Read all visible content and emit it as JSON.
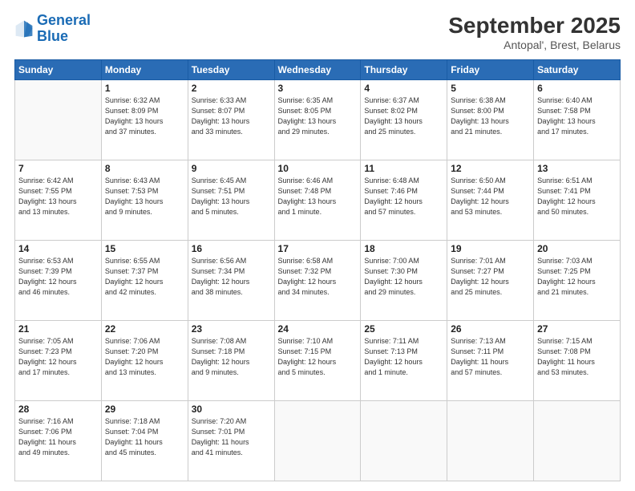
{
  "header": {
    "logo_line1": "General",
    "logo_line2": "Blue",
    "month": "September 2025",
    "location": "Antopal', Brest, Belarus"
  },
  "weekdays": [
    "Sunday",
    "Monday",
    "Tuesday",
    "Wednesday",
    "Thursday",
    "Friday",
    "Saturday"
  ],
  "weeks": [
    [
      {
        "day": "",
        "info": ""
      },
      {
        "day": "1",
        "info": "Sunrise: 6:32 AM\nSunset: 8:09 PM\nDaylight: 13 hours\nand 37 minutes."
      },
      {
        "day": "2",
        "info": "Sunrise: 6:33 AM\nSunset: 8:07 PM\nDaylight: 13 hours\nand 33 minutes."
      },
      {
        "day": "3",
        "info": "Sunrise: 6:35 AM\nSunset: 8:05 PM\nDaylight: 13 hours\nand 29 minutes."
      },
      {
        "day": "4",
        "info": "Sunrise: 6:37 AM\nSunset: 8:02 PM\nDaylight: 13 hours\nand 25 minutes."
      },
      {
        "day": "5",
        "info": "Sunrise: 6:38 AM\nSunset: 8:00 PM\nDaylight: 13 hours\nand 21 minutes."
      },
      {
        "day": "6",
        "info": "Sunrise: 6:40 AM\nSunset: 7:58 PM\nDaylight: 13 hours\nand 17 minutes."
      }
    ],
    [
      {
        "day": "7",
        "info": "Sunrise: 6:42 AM\nSunset: 7:55 PM\nDaylight: 13 hours\nand 13 minutes."
      },
      {
        "day": "8",
        "info": "Sunrise: 6:43 AM\nSunset: 7:53 PM\nDaylight: 13 hours\nand 9 minutes."
      },
      {
        "day": "9",
        "info": "Sunrise: 6:45 AM\nSunset: 7:51 PM\nDaylight: 13 hours\nand 5 minutes."
      },
      {
        "day": "10",
        "info": "Sunrise: 6:46 AM\nSunset: 7:48 PM\nDaylight: 13 hours\nand 1 minute."
      },
      {
        "day": "11",
        "info": "Sunrise: 6:48 AM\nSunset: 7:46 PM\nDaylight: 12 hours\nand 57 minutes."
      },
      {
        "day": "12",
        "info": "Sunrise: 6:50 AM\nSunset: 7:44 PM\nDaylight: 12 hours\nand 53 minutes."
      },
      {
        "day": "13",
        "info": "Sunrise: 6:51 AM\nSunset: 7:41 PM\nDaylight: 12 hours\nand 50 minutes."
      }
    ],
    [
      {
        "day": "14",
        "info": "Sunrise: 6:53 AM\nSunset: 7:39 PM\nDaylight: 12 hours\nand 46 minutes."
      },
      {
        "day": "15",
        "info": "Sunrise: 6:55 AM\nSunset: 7:37 PM\nDaylight: 12 hours\nand 42 minutes."
      },
      {
        "day": "16",
        "info": "Sunrise: 6:56 AM\nSunset: 7:34 PM\nDaylight: 12 hours\nand 38 minutes."
      },
      {
        "day": "17",
        "info": "Sunrise: 6:58 AM\nSunset: 7:32 PM\nDaylight: 12 hours\nand 34 minutes."
      },
      {
        "day": "18",
        "info": "Sunrise: 7:00 AM\nSunset: 7:30 PM\nDaylight: 12 hours\nand 29 minutes."
      },
      {
        "day": "19",
        "info": "Sunrise: 7:01 AM\nSunset: 7:27 PM\nDaylight: 12 hours\nand 25 minutes."
      },
      {
        "day": "20",
        "info": "Sunrise: 7:03 AM\nSunset: 7:25 PM\nDaylight: 12 hours\nand 21 minutes."
      }
    ],
    [
      {
        "day": "21",
        "info": "Sunrise: 7:05 AM\nSunset: 7:23 PM\nDaylight: 12 hours\nand 17 minutes."
      },
      {
        "day": "22",
        "info": "Sunrise: 7:06 AM\nSunset: 7:20 PM\nDaylight: 12 hours\nand 13 minutes."
      },
      {
        "day": "23",
        "info": "Sunrise: 7:08 AM\nSunset: 7:18 PM\nDaylight: 12 hours\nand 9 minutes."
      },
      {
        "day": "24",
        "info": "Sunrise: 7:10 AM\nSunset: 7:15 PM\nDaylight: 12 hours\nand 5 minutes."
      },
      {
        "day": "25",
        "info": "Sunrise: 7:11 AM\nSunset: 7:13 PM\nDaylight: 12 hours\nand 1 minute."
      },
      {
        "day": "26",
        "info": "Sunrise: 7:13 AM\nSunset: 7:11 PM\nDaylight: 11 hours\nand 57 minutes."
      },
      {
        "day": "27",
        "info": "Sunrise: 7:15 AM\nSunset: 7:08 PM\nDaylight: 11 hours\nand 53 minutes."
      }
    ],
    [
      {
        "day": "28",
        "info": "Sunrise: 7:16 AM\nSunset: 7:06 PM\nDaylight: 11 hours\nand 49 minutes."
      },
      {
        "day": "29",
        "info": "Sunrise: 7:18 AM\nSunset: 7:04 PM\nDaylight: 11 hours\nand 45 minutes."
      },
      {
        "day": "30",
        "info": "Sunrise: 7:20 AM\nSunset: 7:01 PM\nDaylight: 11 hours\nand 41 minutes."
      },
      {
        "day": "",
        "info": ""
      },
      {
        "day": "",
        "info": ""
      },
      {
        "day": "",
        "info": ""
      },
      {
        "day": "",
        "info": ""
      }
    ]
  ]
}
